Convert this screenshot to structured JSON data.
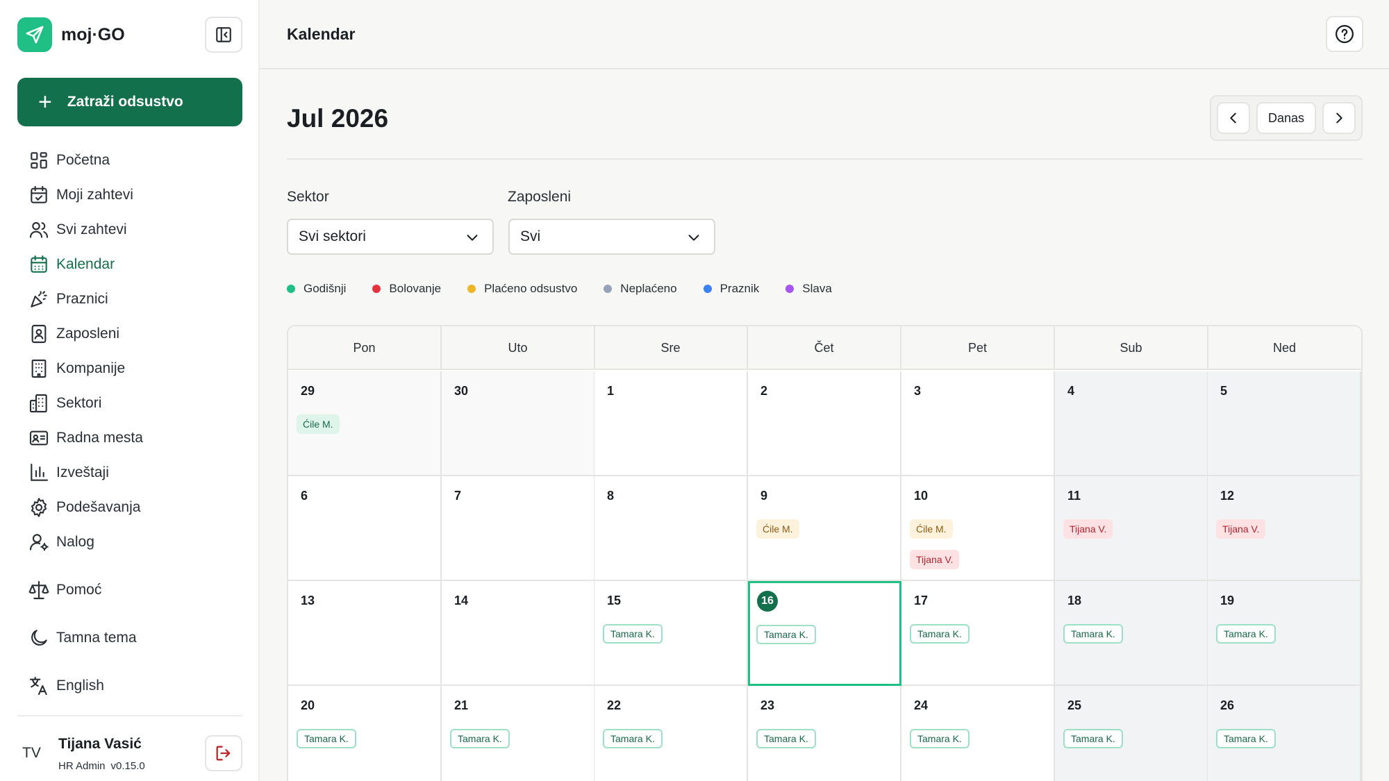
{
  "app": {
    "logo_text": "moj·GO",
    "request_button_label": "Zatraži odsustvo"
  },
  "sidebar": {
    "items": [
      {
        "label": "Početna",
        "icon": "dashboard-icon"
      },
      {
        "label": "Moji zahtevi",
        "icon": "calendar-check-icon"
      },
      {
        "label": "Svi zahtevi",
        "icon": "users-icon"
      },
      {
        "label": "Kalendar",
        "icon": "calendar-icon"
      },
      {
        "label": "Praznici",
        "icon": "party-icon"
      },
      {
        "label": "Zaposleni",
        "icon": "id-badge-icon"
      },
      {
        "label": "Kompanije",
        "icon": "building-icon"
      },
      {
        "label": "Sektori",
        "icon": "office-icon"
      },
      {
        "label": "Radna mesta",
        "icon": "id-card-icon"
      },
      {
        "label": "Izveštaji",
        "icon": "bar-chart-icon"
      },
      {
        "label": "Podešavanja",
        "icon": "gear-icon"
      },
      {
        "label": "Nalog",
        "icon": "user-gear-icon"
      }
    ],
    "secondary": [
      {
        "label": "Pomoć",
        "icon": "scales-icon"
      },
      {
        "label": "Tamna tema",
        "icon": "moon-icon"
      },
      {
        "label": "English",
        "icon": "translate-icon"
      }
    ]
  },
  "user": {
    "initials": "TV",
    "name": "Tijana Vasić",
    "role": "HR Admin",
    "version": "v0.15.0"
  },
  "header": {
    "title": "Kalendar"
  },
  "calendar": {
    "month_title": "Jul 2026",
    "today_label": "Danas",
    "weekdays": [
      "Pon",
      "Uto",
      "Sre",
      "Čet",
      "Pet",
      "Sub",
      "Ned"
    ],
    "weeks": [
      [
        {
          "day": "29",
          "outside": true,
          "events": [
            {
              "name": "Ćile M.",
              "style": "green-soft"
            }
          ]
        },
        {
          "day": "30",
          "outside": true,
          "events": []
        },
        {
          "day": "1",
          "events": []
        },
        {
          "day": "2",
          "events": []
        },
        {
          "day": "3",
          "events": []
        },
        {
          "day": "4",
          "weekend": true,
          "events": []
        },
        {
          "day": "5",
          "weekend": true,
          "events": []
        }
      ],
      [
        {
          "day": "6",
          "events": []
        },
        {
          "day": "7",
          "events": []
        },
        {
          "day": "8",
          "events": []
        },
        {
          "day": "9",
          "events": [
            {
              "name": "Ćile M.",
              "style": "amber"
            }
          ]
        },
        {
          "day": "10",
          "events": [
            {
              "name": "Ćile M.",
              "style": "amber"
            },
            {
              "name": "Tijana V.",
              "style": "red"
            }
          ]
        },
        {
          "day": "11",
          "weekend": true,
          "events": [
            {
              "name": "Tijana V.",
              "style": "red"
            }
          ]
        },
        {
          "day": "12",
          "weekend": true,
          "events": [
            {
              "name": "Tijana V.",
              "style": "red"
            }
          ]
        }
      ],
      [
        {
          "day": "13",
          "events": []
        },
        {
          "day": "14",
          "events": []
        },
        {
          "day": "15",
          "events": [
            {
              "name": "Tamara K.",
              "style": "green-outline"
            }
          ]
        },
        {
          "day": "16",
          "today": true,
          "events": [
            {
              "name": "Tamara K.",
              "style": "green-outline"
            }
          ]
        },
        {
          "day": "17",
          "events": [
            {
              "name": "Tamara K.",
              "style": "green-outline"
            }
          ]
        },
        {
          "day": "18",
          "weekend": true,
          "events": [
            {
              "name": "Tamara K.",
              "style": "green-outline"
            }
          ]
        },
        {
          "day": "19",
          "weekend": true,
          "events": [
            {
              "name": "Tamara K.",
              "style": "green-outline"
            }
          ]
        }
      ],
      [
        {
          "day": "20",
          "events": [
            {
              "name": "Tamara K.",
              "style": "green-outline"
            }
          ]
        },
        {
          "day": "21",
          "events": [
            {
              "name": "Tamara K.",
              "style": "green-outline"
            }
          ]
        },
        {
          "day": "22",
          "events": [
            {
              "name": "Tamara K.",
              "style": "green-outline"
            }
          ]
        },
        {
          "day": "23",
          "events": [
            {
              "name": "Tamara K.",
              "style": "green-outline"
            }
          ]
        },
        {
          "day": "24",
          "events": [
            {
              "name": "Tamara K.",
              "style": "green-outline"
            }
          ]
        },
        {
          "day": "25",
          "weekend": true,
          "events": [
            {
              "name": "Tamara K.",
              "style": "green-outline"
            }
          ]
        },
        {
          "day": "26",
          "weekend": true,
          "events": [
            {
              "name": "Tamara K.",
              "style": "green-outline"
            }
          ]
        }
      ]
    ]
  },
  "filters": {
    "sector_label": "Sektor",
    "sector_value": "Svi sektori",
    "employee_label": "Zaposleni",
    "employee_value": "Svi"
  },
  "legend": [
    {
      "label": "Godišnji",
      "color": "#1fbf85"
    },
    {
      "label": "Bolovanje",
      "color": "#e5323e"
    },
    {
      "label": "Plaćeno odsustvo",
      "color": "#f0b429"
    },
    {
      "label": "Neplaćeno",
      "color": "#94a3b8"
    },
    {
      "label": "Praznik",
      "color": "#3b82f6"
    },
    {
      "label": "Slava",
      "color": "#a855f7"
    }
  ],
  "colors": {
    "brand_primary": "#13704c",
    "brand_accent": "#1fbf85"
  }
}
